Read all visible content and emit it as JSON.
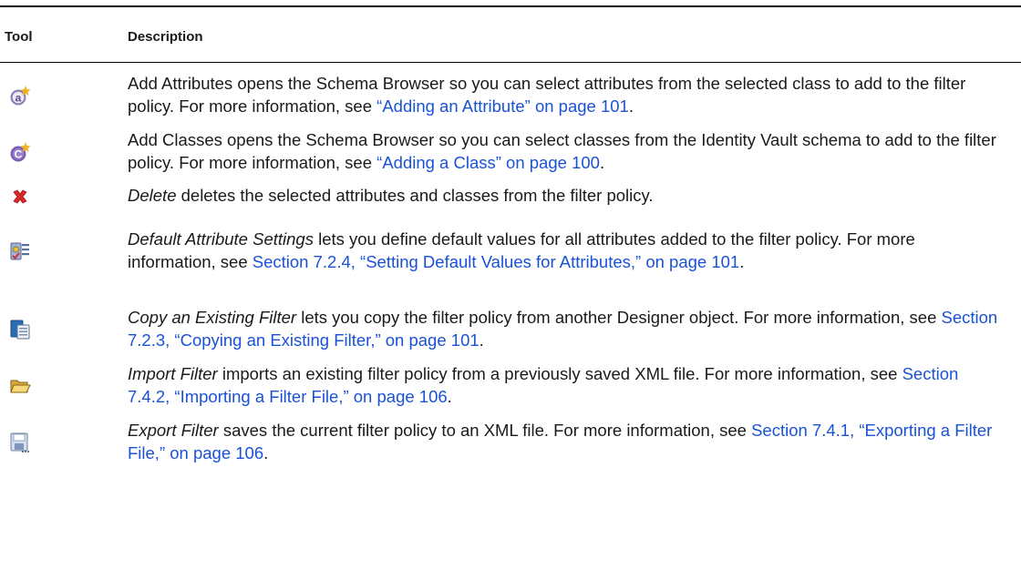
{
  "table": {
    "headers": {
      "tool": "Tool",
      "description": "Description"
    },
    "rows": [
      {
        "icon": "add-attribute-icon",
        "pre": "",
        "italic": "",
        "text": "Add Attributes opens the Schema Browser so you can select attributes from the selected class to add to the filter policy. For more information, see ",
        "link": "“Adding an Attribute” on page 101",
        "post": "."
      },
      {
        "icon": "add-class-icon",
        "pre": "",
        "italic": "",
        "text": "Add Classes opens the Schema Browser so you can select classes from the Identity Vault schema to add to the filter policy. For more information, see ",
        "link": "“Adding a Class” on page 100",
        "post": "."
      },
      {
        "icon": "delete-icon",
        "pre": "",
        "italic": "Delete",
        "text": " deletes the selected attributes and classes from the filter policy.",
        "link": "",
        "post": ""
      },
      {
        "icon": "default-attribute-settings-icon",
        "pre": "",
        "italic": "Default Attribute Settings",
        "text": " lets you define default values for all attributes added to the filter policy. For more information, see ",
        "link": "Section 7.2.4, “Setting Default Values for Attributes,” on page 101",
        "post": "."
      },
      {
        "icon": "copy-filter-icon",
        "pre": "",
        "italic": "Copy an Existing Filter",
        "text": " lets you copy the filter policy from another Designer object. For more information, see ",
        "link": "Section 7.2.3, “Copying an Existing Filter,” on page 101",
        "post": "."
      },
      {
        "icon": "import-filter-icon",
        "pre": "",
        "italic": "Import Filter",
        "text": " imports an existing filter policy from a previously saved XML file. For more information, see ",
        "link": "Section 7.4.2, “Importing a Filter File,” on page 106",
        "post": "."
      },
      {
        "icon": "export-filter-icon",
        "pre": "",
        "italic": "Export Filter",
        "text": " saves the current filter policy to an XML file. For more information, see ",
        "link": "Section 7.4.1, “Exporting a Filter File,” on page 106",
        "post": "."
      }
    ]
  }
}
